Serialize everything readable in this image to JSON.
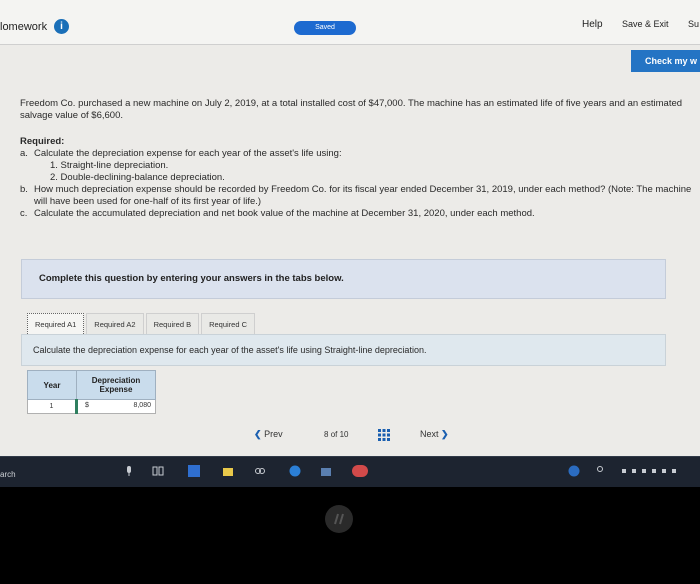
{
  "header": {
    "title": "lomework",
    "saved_label": "Saved",
    "help_label": "Help",
    "save_exit_label": "Save & Exit",
    "submit_label": "Su",
    "check_label": "Check my w"
  },
  "problem": {
    "statement": "Freedom Co. purchased a new machine on July 2, 2019, at a total installed cost of $47,000. The machine has an estimated life of five years and an estimated salvage value of $6,600.",
    "required_label": "Required:",
    "items": [
      {
        "letter": "a.",
        "text": "Calculate the depreciation expense for each year of the asset's life using:"
      },
      {
        "letter": "",
        "text": "1. Straight-line depreciation."
      },
      {
        "letter": "",
        "text": "2. Double-declining-balance depreciation."
      },
      {
        "letter": "b.",
        "text": "How much depreciation expense should be recorded by Freedom Co. for its fiscal year ended December 31, 2019, under each method? (Note: The machine will have been used for one-half of its first year of life.)"
      },
      {
        "letter": "c.",
        "text": "Calculate the accumulated depreciation and net book value of the machine at December 31, 2020, under each method."
      }
    ]
  },
  "complete_prompt": "Complete this question by entering your answers in the tabs below.",
  "tabs": [
    {
      "label": "Required A1",
      "active": true
    },
    {
      "label": "Required A2",
      "active": false
    },
    {
      "label": "Required B",
      "active": false
    },
    {
      "label": "Required C",
      "active": false
    }
  ],
  "instruction": "Calculate the depreciation expense for each year of the asset's life using Straight-line depreciation.",
  "table": {
    "header_year": "Year",
    "header_dep_1": "Depreciation",
    "header_dep_2": "Expense",
    "rows": [
      {
        "year": "1",
        "currency": "$",
        "amount": "8,080"
      }
    ]
  },
  "pager": {
    "prev_label": "Prev",
    "page_current": "8",
    "page_of": "of",
    "page_total": "10",
    "next_label": "Next"
  },
  "taskbar": {
    "search_label": "arch"
  },
  "colors": {
    "accent_blue": "#2474c4",
    "header_blue": "#c9dcec",
    "taskbar": "#1d2430"
  }
}
